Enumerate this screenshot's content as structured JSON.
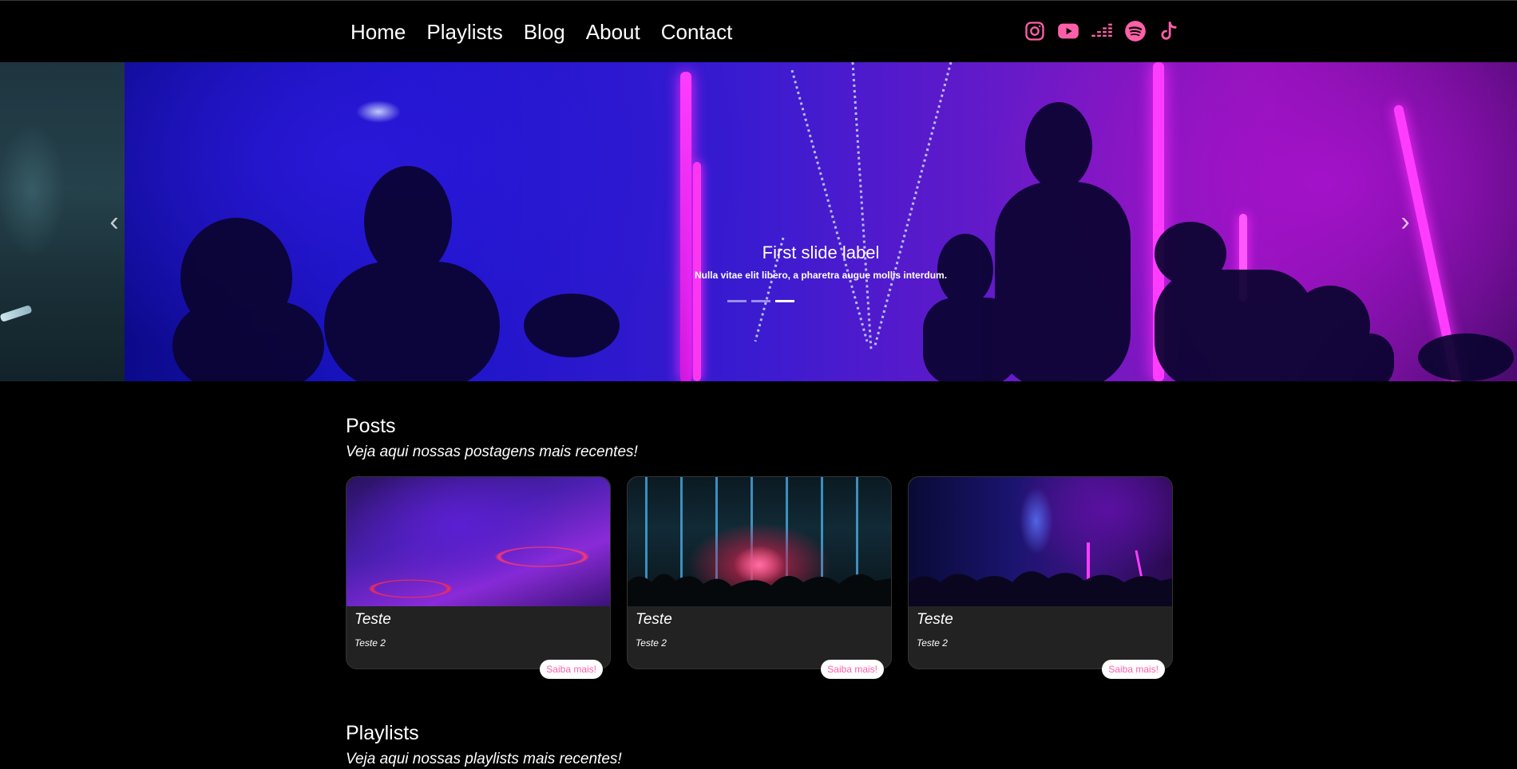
{
  "nav": {
    "links": [
      "Home",
      "Playlists",
      "Blog",
      "About",
      "Contact"
    ],
    "socials": [
      "instagram-icon",
      "youtube-icon",
      "deezer-icon",
      "spotify-icon",
      "tiktok-icon"
    ],
    "accent_color": "#ff5fa8"
  },
  "carousel": {
    "caption_title": "First slide label",
    "caption_text": "Nulla vitae elit libero, a pharetra augue mollis interdum.",
    "indicators": 3,
    "active_index": 2,
    "prev_icon": "chevron-left-icon",
    "next_icon": "chevron-right-icon"
  },
  "posts": {
    "title": "Posts",
    "subtitle": "Veja aqui nossas postagens mais recentes!",
    "cards": [
      {
        "title": "Teste",
        "text": "Teste 2",
        "button": "Saiba mais!"
      },
      {
        "title": "Teste",
        "text": "Teste 2",
        "button": "Saiba mais!"
      },
      {
        "title": "Teste",
        "text": "Teste 2",
        "button": "Saiba mais!"
      }
    ]
  },
  "playlists": {
    "title": "Playlists",
    "subtitle": "Veja aqui nossas playlists mais recentes!"
  }
}
